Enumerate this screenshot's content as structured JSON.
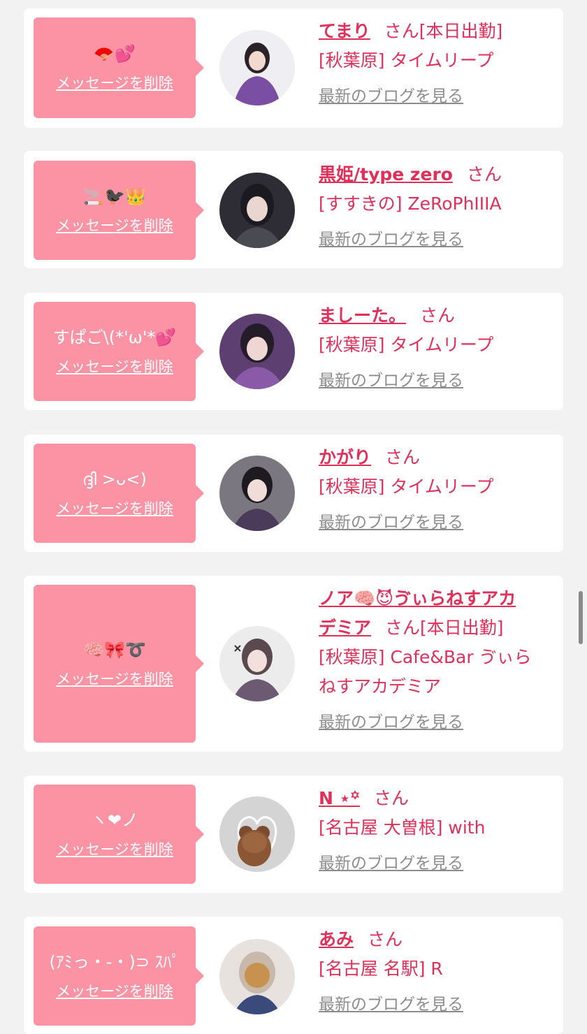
{
  "cards": [
    {
      "message": "🪭💕",
      "delete_label": "メッセージを削除",
      "name": "てまり",
      "san": "さん",
      "work_status": "[本日出勤]",
      "shop": "[秋葉原] タイムリープ",
      "blog_label": "最新のブログを見る",
      "avatar_color": "#7a4fa3"
    },
    {
      "message": "🚬🐦‍⬛👑",
      "delete_label": "メッセージを削除",
      "name": "黒姫/type zero",
      "san": "さん",
      "work_status": "",
      "shop": "[すすきの] ZeRoPhIIIA",
      "blog_label": "最新のブログを見る",
      "avatar_color": "#3b3b44"
    },
    {
      "message": "すぱご\\(*'ω'*💕",
      "delete_label": "メッセージを削除",
      "name": "ましーた。",
      "san": "さん",
      "work_status": "",
      "shop": "[秋葉原] タイムリープ",
      "blog_label": "最新のブログを見る",
      "avatar_color": "#8a5aa8"
    },
    {
      "message": "ദ്ദി >ᴗ<)",
      "delete_label": "メッセージを削除",
      "name": "かがり",
      "san": "さん",
      "work_status": "",
      "shop": "[秋葉原] タイムリープ",
      "blog_label": "最新のブログを見る",
      "avatar_color": "#4b3b5a"
    },
    {
      "message": "🧠🎀➰",
      "delete_label": "メッセージを削除",
      "name_line1": "ノア🧠😈ゔぃらねすアカ",
      "name_line2": "デミア",
      "san": "さん",
      "work_status": "[本日出勤]",
      "shop_line1": "[秋葉原] Cafe&Bar ゔぃら",
      "shop_line2": "ねすアカデミア",
      "blog_label": "最新のブログを見る",
      "avatar_color": "#6c5a72"
    },
    {
      "message": "ヽ❤︎ノ",
      "delete_label": "メッセージを削除",
      "name": "N ⋆꙳",
      "san": "さん",
      "work_status": "",
      "shop": "[名古屋 大曽根] with",
      "blog_label": "最新のブログを見る",
      "avatar_color": "#cfcfcf"
    },
    {
      "message": "(ｱﾐっ・-・)⊃ ｽﾊﾟ",
      "delete_label": "メッセージを削除",
      "name": "あみ",
      "san": "さん",
      "work_status": "",
      "shop": "[名古屋 名駅] R",
      "blog_label": "最新のブログを見る",
      "avatar_color": "#d9c8bd"
    }
  ],
  "colors": {
    "accent": "#e0305a",
    "bubble": "#fb93a4",
    "link_gray": "#8c8c8c",
    "background": "#f2f2f2"
  }
}
